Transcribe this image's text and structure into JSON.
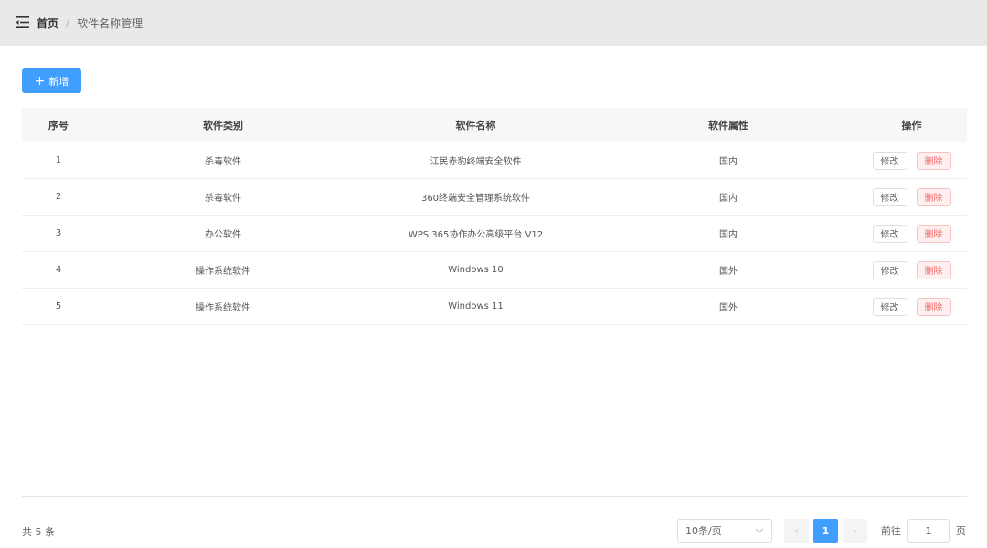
{
  "header": {
    "breadcrumb_home": "首页",
    "breadcrumb_separator": "/",
    "breadcrumb_current": "软件名称管理"
  },
  "toolbar": {
    "add_icon": "+",
    "add_label": "新增"
  },
  "table": {
    "columns": [
      "序号",
      "软件类别",
      "软件名称",
      "软件属性",
      "操作"
    ],
    "rows": [
      {
        "index": "1",
        "category": "杀毒软件",
        "name": "江民赤豹终端安全软件",
        "attr": "国内",
        "edit": "修改",
        "delete": "删除"
      },
      {
        "index": "2",
        "category": "杀毒软件",
        "name": "360终端安全管理系统软件",
        "attr": "国内",
        "edit": "修改",
        "delete": "删除"
      },
      {
        "index": "3",
        "category": "办公软件",
        "name": "WPS 365协作办公高级平台 V12",
        "attr": "国内",
        "edit": "修改",
        "delete": "删除"
      },
      {
        "index": "4",
        "category": "操作系统软件",
        "name": "Windows 10",
        "attr": "国外",
        "edit": "修改",
        "delete": "删除"
      },
      {
        "index": "5",
        "category": "操作系统软件",
        "name": "Windows 11",
        "attr": "国外",
        "edit": "修改",
        "delete": "删除"
      }
    ]
  },
  "pagination": {
    "total_text": "共 5 条",
    "page_size": "10条/页",
    "prev_glyph": "‹",
    "next_glyph": "›",
    "current_page": "1",
    "goto_prefix": "前往",
    "goto_value": "1",
    "goto_suffix": "页"
  },
  "colors": {
    "primary": "#409eff",
    "danger": "#f56c6c",
    "header_bg": "#e9e9e9"
  }
}
